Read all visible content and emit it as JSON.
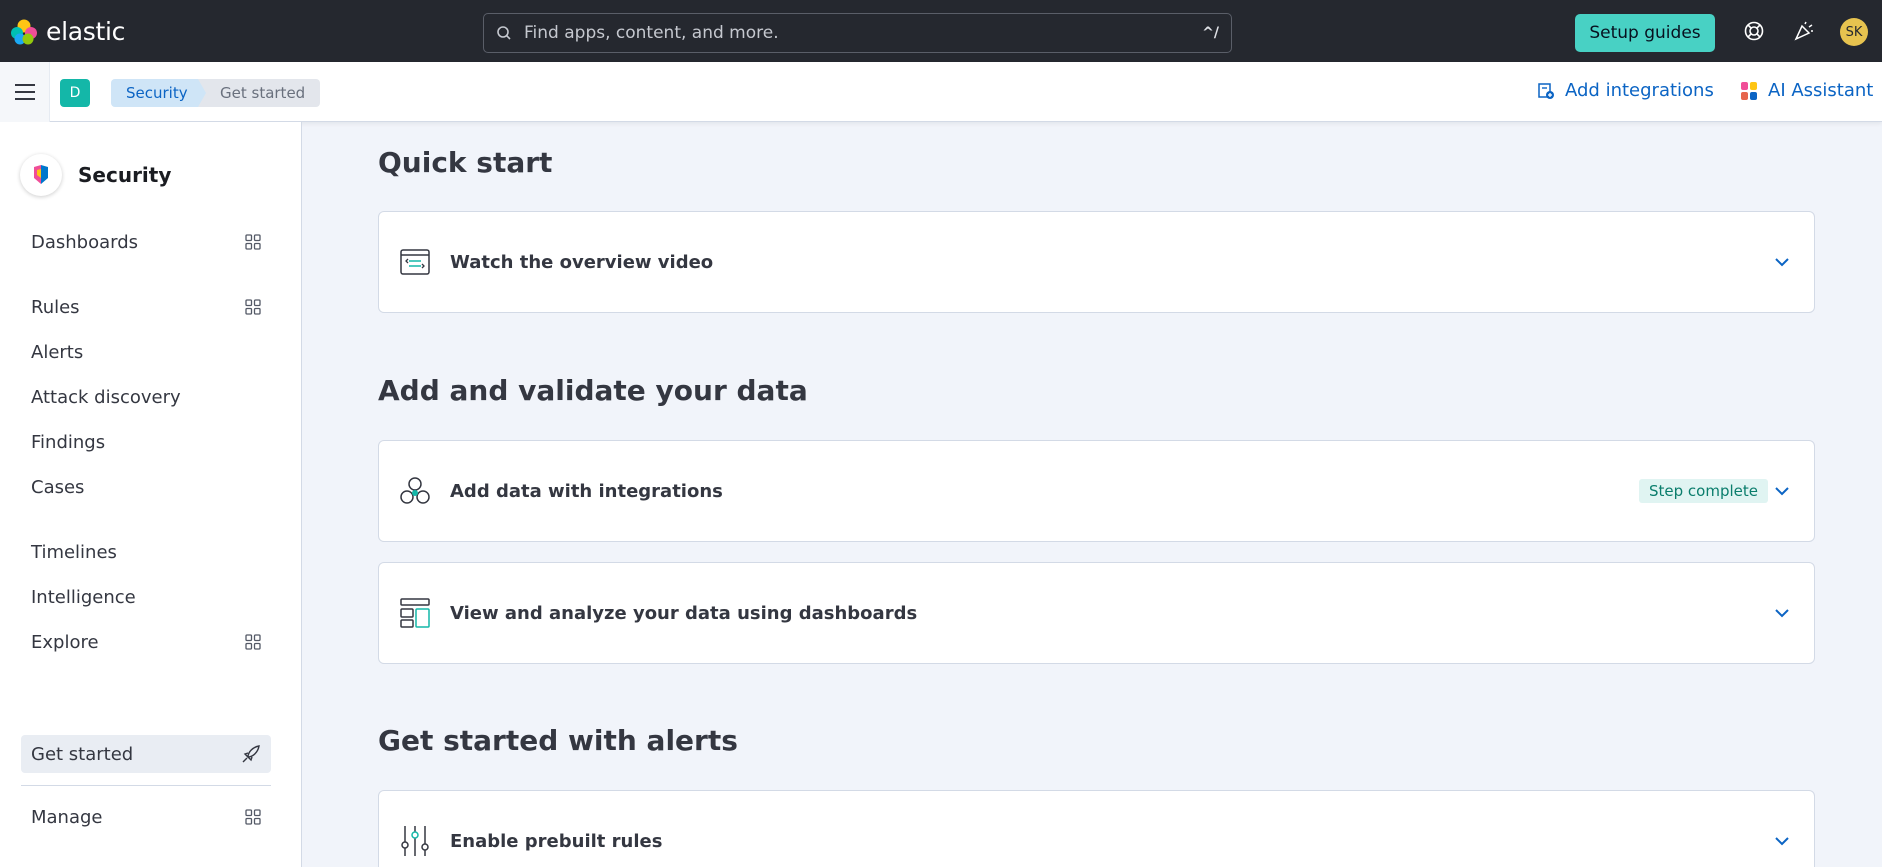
{
  "header": {
    "brand": "elastic",
    "search_placeholder": "Find apps, content, and more.",
    "search_shortcut": "^/",
    "setup_guides_label": "Setup guides",
    "avatar_initials": "SK"
  },
  "subbar": {
    "space_initial": "D",
    "breadcrumbs": [
      "Security",
      "Get started"
    ],
    "add_integrations_label": "Add integrations",
    "ai_assistant_label": "AI Assistant"
  },
  "sidebar": {
    "title": "Security",
    "items": [
      {
        "label": "Dashboards",
        "icon": "grid-icon"
      },
      {
        "label": "Rules",
        "icon": "grid-icon"
      },
      {
        "label": "Alerts"
      },
      {
        "label": "Attack discovery"
      },
      {
        "label": "Findings"
      },
      {
        "label": "Cases"
      },
      {
        "label": "Timelines"
      },
      {
        "label": "Intelligence"
      },
      {
        "label": "Explore",
        "icon": "grid-icon"
      },
      {
        "label": "Get started",
        "icon": "rocket-icon",
        "active": true
      },
      {
        "label": "Manage",
        "icon": "grid-icon"
      }
    ]
  },
  "main": {
    "sections": [
      {
        "title": "Quick start",
        "cards": [
          {
            "label": "Watch the overview video",
            "icon": "video-icon"
          }
        ]
      },
      {
        "title": "Add and validate your data",
        "cards": [
          {
            "label": "Add data with integrations",
            "icon": "integrations-icon",
            "badge": "Step complete"
          },
          {
            "label": "View and analyze your data using dashboards",
            "icon": "dashboard-layout-icon"
          }
        ]
      },
      {
        "title": "Get started with alerts",
        "cards": [
          {
            "label": "Enable prebuilt rules",
            "icon": "sliders-icon"
          }
        ]
      }
    ]
  },
  "colors": {
    "header_bg": "#25282f",
    "accent_teal": "#48d1c4",
    "link_blue": "#0b64c4",
    "page_bg": "#f1f4fa"
  }
}
